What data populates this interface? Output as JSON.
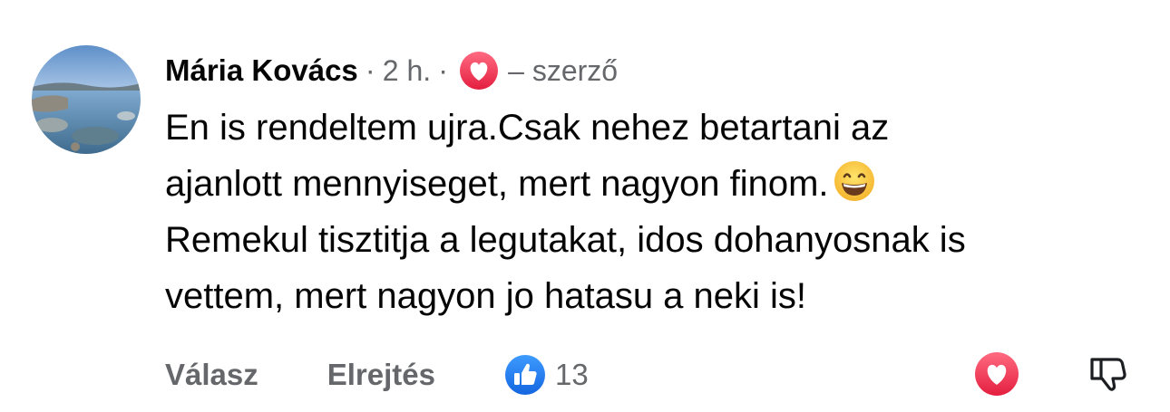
{
  "comment": {
    "author": "Mária Kovács",
    "separator": "·",
    "time": "2 h.",
    "author_badge_icon": "heart-icon",
    "role": "– szerző",
    "text_lines": [
      "En is rendeltem ujra.Csak nehez betartani az",
      "ajanlott mennyiseget, mert nagyon finom.",
      "Remekul tisztitja a legutakat, idos dohanyosnak is",
      "vettem, mert nagyon jo hatasu a neki is!"
    ],
    "emoji_icon": "grinning-face-icon"
  },
  "actions": {
    "reply_label": "Válasz",
    "hide_label": "Elrejtés",
    "like_icon": "thumbs-up-icon",
    "like_count": "13",
    "react_icon": "heart-outline-icon",
    "dislike_icon": "thumbs-down-icon"
  },
  "colors": {
    "text_primary": "#050505",
    "text_secondary": "#65676b",
    "like_blue": "#1877f2",
    "heart_red": "#f33e58"
  }
}
